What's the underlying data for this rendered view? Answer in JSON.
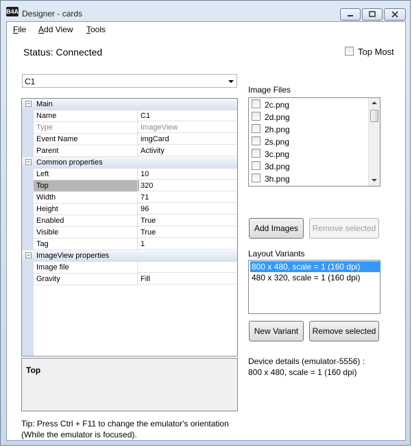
{
  "window": {
    "title": "Designer - cards",
    "app_icon_text": "B4A"
  },
  "menu": [
    {
      "label": "File",
      "mnemonic": "F",
      "rest": "ile"
    },
    {
      "label": "Add View",
      "mnemonic": "A",
      "rest": "dd View"
    },
    {
      "label": "Tools",
      "mnemonic": "T",
      "rest": "ools"
    }
  ],
  "status": "Status: Connected",
  "top_most": {
    "label": "Top Most",
    "checked": false
  },
  "view_selector": {
    "value": "C1"
  },
  "property_grid": {
    "categories": [
      {
        "label": "Main",
        "rows": [
          {
            "name": "Name",
            "value": "C1"
          },
          {
            "name": "Type",
            "value": "ImageView",
            "dim": true
          },
          {
            "name": "Event Name",
            "value": "imgCard"
          },
          {
            "name": "Parent",
            "value": "Activity"
          }
        ]
      },
      {
        "label": "Common properties",
        "rows": [
          {
            "name": "Left",
            "value": "10"
          },
          {
            "name": "Top",
            "value": "320",
            "selected": true
          },
          {
            "name": "Width",
            "value": "71"
          },
          {
            "name": "Height",
            "value": "96"
          },
          {
            "name": "Enabled",
            "value": "True"
          },
          {
            "name": "Visible",
            "value": "True"
          },
          {
            "name": "Tag",
            "value": "1"
          }
        ]
      },
      {
        "label": "ImageView properties",
        "rows": [
          {
            "name": "Image file",
            "value": ""
          },
          {
            "name": "Gravity",
            "value": "Fill"
          }
        ]
      }
    ]
  },
  "help": {
    "title": "Top"
  },
  "tip": {
    "line1": "Tip: Press Ctrl + F11 to change the emulator's orientation",
    "line2": "(While the emulator is focused)."
  },
  "image_files": {
    "label": "Image Files",
    "items": [
      "2c.png",
      "2d.png",
      "2h.png",
      "2s.png",
      "3c.png",
      "3d.png",
      "3h.png"
    ]
  },
  "buttons": {
    "add_images": "Add Images",
    "remove_selected_images": "Remove selected",
    "new_variant": "New Variant",
    "remove_selected_variant": "Remove selected"
  },
  "layout_variants": {
    "label": "Layout Variants",
    "items": [
      {
        "text": "800 x 480, scale = 1 (160 dpi)",
        "selected": true
      },
      {
        "text": "480 x 320, scale = 1 (160 dpi)",
        "selected": false
      }
    ]
  },
  "device_details": {
    "line1": "Device details (emulator-5556) :",
    "line2": "800 x 480, scale = 1 (160 dpi)"
  }
}
